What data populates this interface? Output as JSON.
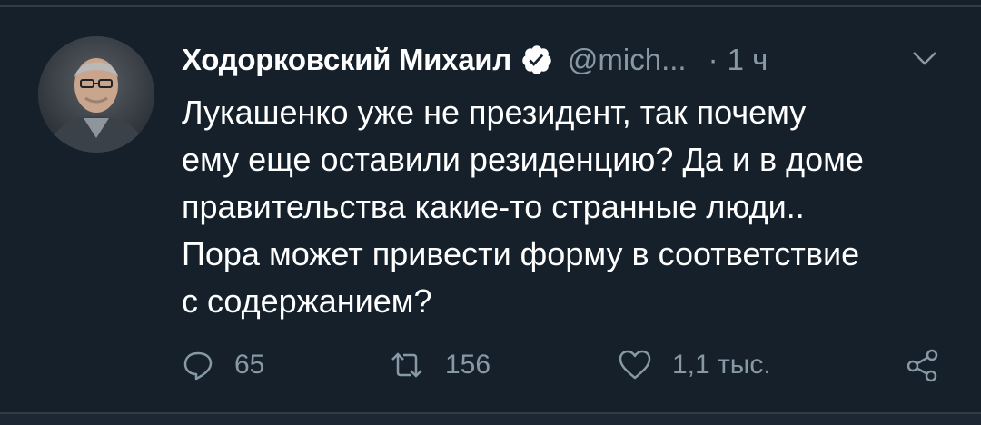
{
  "tweet": {
    "author_name": "Ходорковский Михаил",
    "handle": "@mich...",
    "separator": "·",
    "time": "1 ч",
    "lines": [
      "Лукашенко уже не президент, так почему",
      "ему еще оставили резиденцию? Да и в доме",
      "правительства какие-то странные люди..",
      "Пора может привести форму в соответствие",
      "с содержанием?"
    ]
  },
  "actions": {
    "replies": "65",
    "retweets": "156",
    "likes": "1,1 тыс."
  },
  "icons": {
    "verified": "verified-badge-icon",
    "menu": "chevron-down-icon",
    "reply": "reply-icon",
    "retweet": "retweet-icon",
    "like": "heart-icon",
    "share": "share-icon"
  },
  "colors": {
    "background": "#15202b",
    "primary_text": "#ffffff",
    "secondary_text": "#8899a6"
  }
}
